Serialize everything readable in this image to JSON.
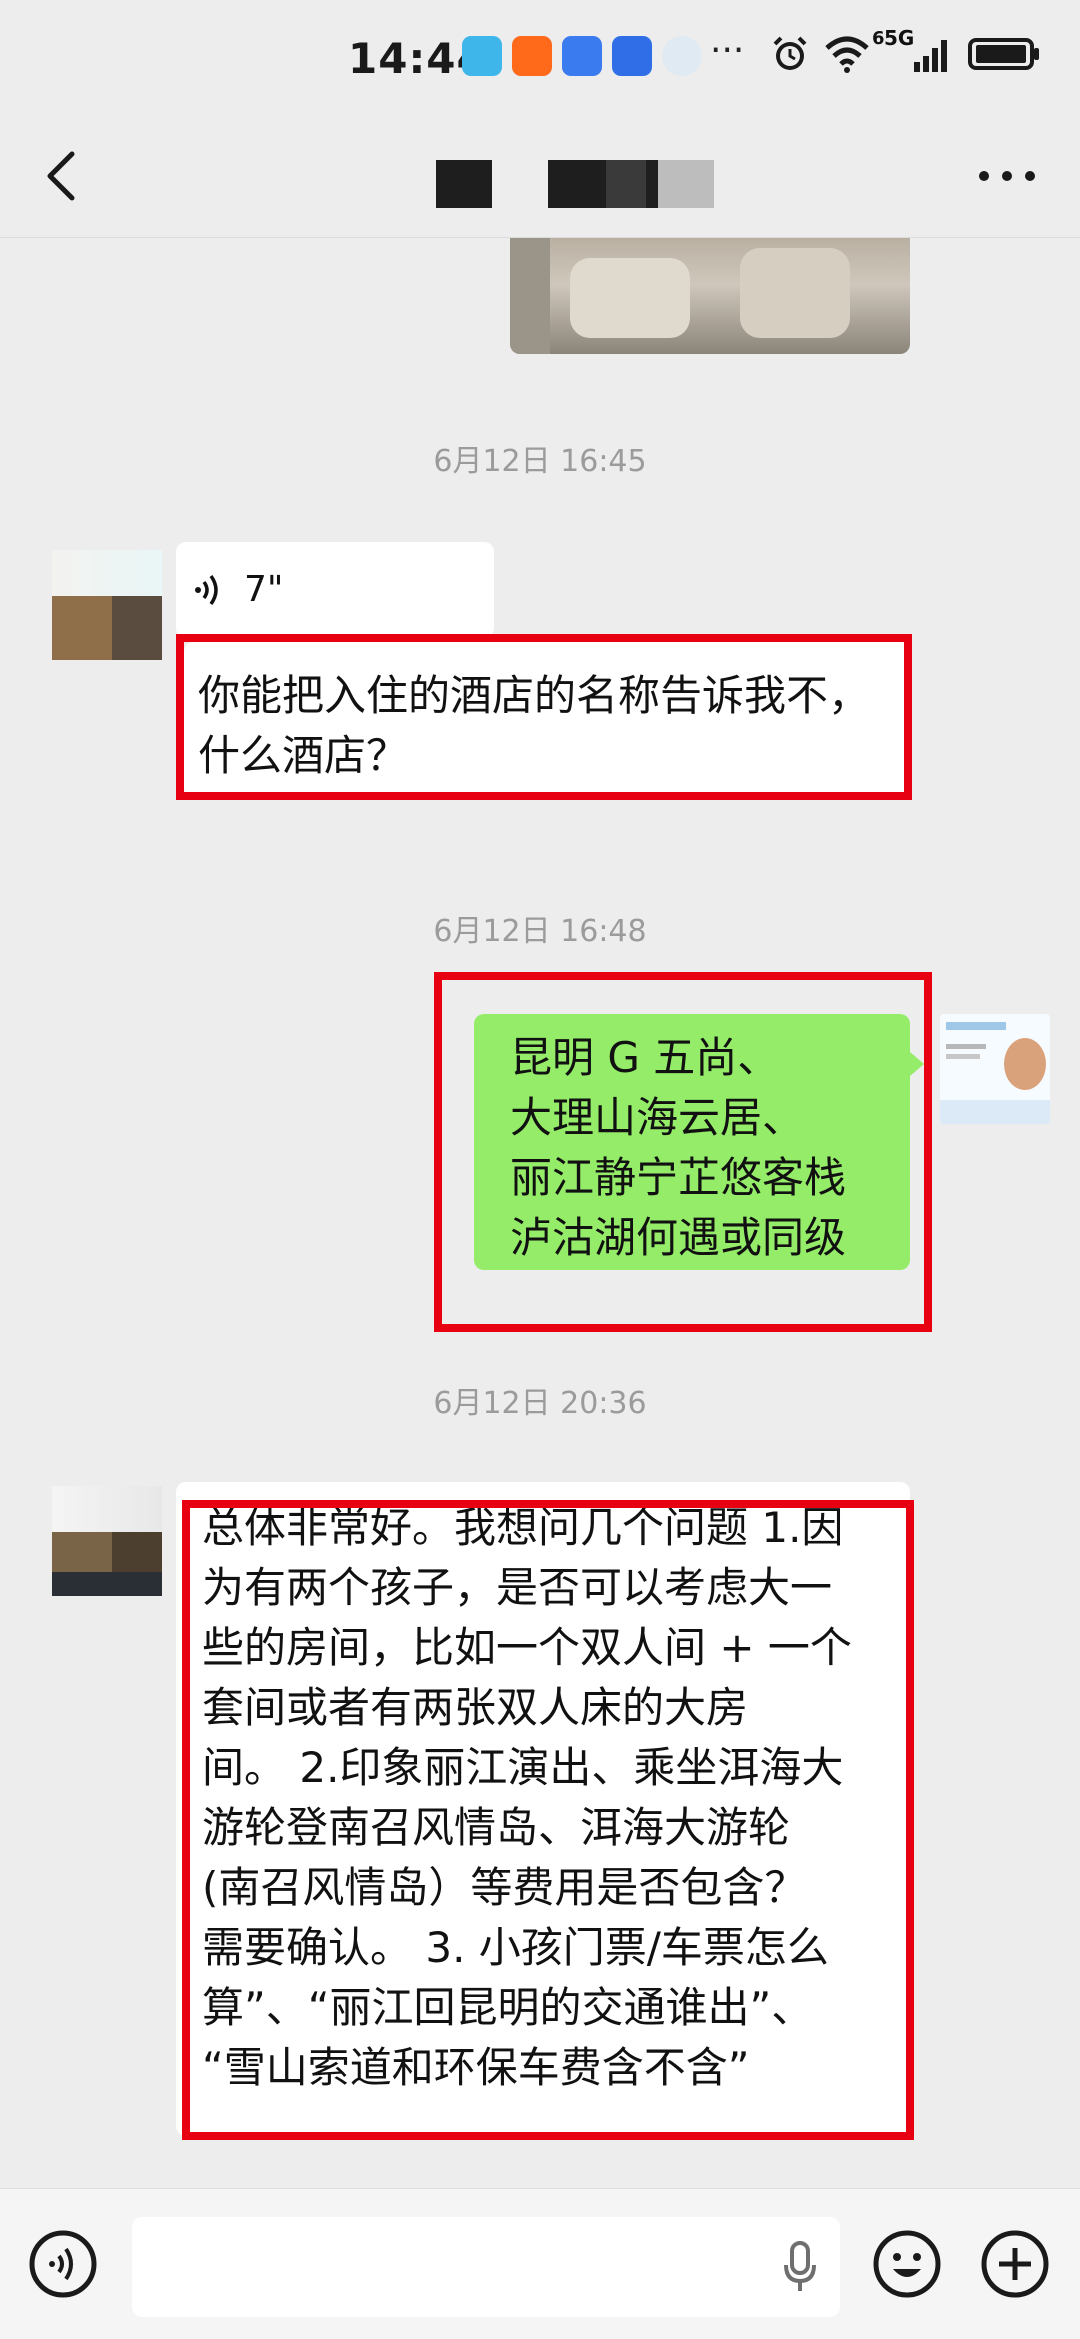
{
  "status": {
    "time": "14:44",
    "network": "5G",
    "sim_tag": "6"
  },
  "header": {
    "back_icon": "chevron-left-icon",
    "menu_icon": "more-horizontal-icon"
  },
  "messages": [
    {
      "type": "timestamp",
      "text": "6月12日 16:45"
    },
    {
      "type": "voice",
      "side": "left",
      "duration": "7\""
    },
    {
      "type": "text",
      "side": "left",
      "text": "你能把入住的酒店的名称告诉我不，什么酒店？"
    },
    {
      "type": "timestamp",
      "text": "6月12日 16:48"
    },
    {
      "type": "text",
      "side": "right",
      "lines": [
        "昆明 G 五尚、",
        "大理山海云居、",
        "丽江静宁芷悠客栈",
        "泸沽湖何遇或同级"
      ]
    },
    {
      "type": "timestamp",
      "text": "6月12日 20:36"
    },
    {
      "type": "text",
      "side": "left",
      "lines": [
        "总体非常好。我想问几个问题 1.因",
        "为有两个孩子，是否可以考虑大一",
        "些的房间，比如一个双人间 + 一个",
        "套间或者有两张双人床的大房",
        "间。 2.印象丽江演出、乘坐洱海大",
        "游轮登南召风情岛、洱海大游轮",
        "(南召风情岛）等费用是否包含？",
        "需要确认。 3. 小孩门票/车票怎么",
        "算”、“丽江回昆明的交通谁出”、",
        "“雪山索道和环保车费含不含”"
      ]
    }
  ],
  "input_bar": {
    "voice_icon": "voice-mode-icon",
    "mic_icon": "microphone-icon",
    "emoji_icon": "emoji-icon",
    "plus_icon": "plus-icon"
  }
}
